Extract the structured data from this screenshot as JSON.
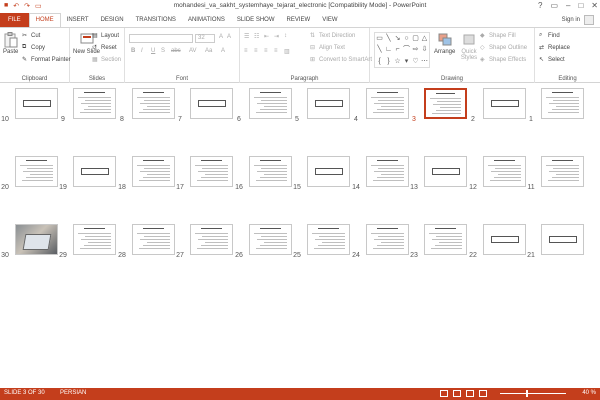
{
  "window": {
    "title": "mohandesi_va_sakht_systemhaye_tejarat_electronic [Compatibility Mode] - PowerPoint",
    "controls": [
      "?",
      "▭",
      "–",
      "□",
      "✕"
    ]
  },
  "tabs": [
    "FILE",
    "HOME",
    "INSERT",
    "DESIGN",
    "TRANSITIONS",
    "ANIMATIONS",
    "SLIDE SHOW",
    "REVIEW",
    "VIEW"
  ],
  "active_tab": "HOME",
  "sign_in": "Sign in",
  "ribbon": {
    "clipboard": {
      "label": "Clipboard",
      "paste": "Paste",
      "cut": "Cut",
      "copy": "Copy",
      "format_painter": "Format Painter"
    },
    "slides": {
      "label": "Slides",
      "new_slide": "New Slide",
      "layout": "Layout",
      "reset": "Reset",
      "section": "Section"
    },
    "font": {
      "label": "Font",
      "size": "32"
    },
    "paragraph": {
      "label": "Paragraph",
      "text_direction": "Text Direction",
      "align_text": "Align Text",
      "convert_smartart": "Convert to SmartArt"
    },
    "drawing": {
      "label": "Drawing",
      "arrange": "Arrange",
      "quick_styles": "Quick Styles",
      "shape_fill": "Shape Fill",
      "shape_outline": "Shape Outline",
      "shape_effects": "Shape Effects"
    },
    "editing": {
      "label": "Editing",
      "find": "Find",
      "replace": "Replace",
      "select": "Select"
    }
  },
  "slides": [
    {
      "num": "1",
      "layout": "text"
    },
    {
      "num": "2",
      "layout": "title"
    },
    {
      "num": "3",
      "layout": "text",
      "selected": true
    },
    {
      "num": "4",
      "layout": "text"
    },
    {
      "num": "5",
      "layout": "title"
    },
    {
      "num": "6",
      "layout": "text"
    },
    {
      "num": "7",
      "layout": "title"
    },
    {
      "num": "8",
      "layout": "text"
    },
    {
      "num": "9",
      "layout": "text"
    },
    {
      "num": "10",
      "layout": "title"
    },
    {
      "num": "11",
      "layout": "text"
    },
    {
      "num": "12",
      "layout": "text"
    },
    {
      "num": "13",
      "layout": "title"
    },
    {
      "num": "14",
      "layout": "text"
    },
    {
      "num": "15",
      "layout": "title"
    },
    {
      "num": "16",
      "layout": "text"
    },
    {
      "num": "17",
      "layout": "text"
    },
    {
      "num": "18",
      "layout": "text"
    },
    {
      "num": "19",
      "layout": "title"
    },
    {
      "num": "20",
      "layout": "text"
    },
    {
      "num": "21",
      "layout": "title"
    },
    {
      "num": "22",
      "layout": "title"
    },
    {
      "num": "23",
      "layout": "text"
    },
    {
      "num": "24",
      "layout": "text"
    },
    {
      "num": "25",
      "layout": "text"
    },
    {
      "num": "26",
      "layout": "text"
    },
    {
      "num": "27",
      "layout": "text"
    },
    {
      "num": "28",
      "layout": "text"
    },
    {
      "num": "29",
      "layout": "text"
    },
    {
      "num": "30",
      "layout": "photo"
    }
  ],
  "status": {
    "slide_of": "SLIDE 3 OF 30",
    "language": "PERSIAN",
    "zoom": "40 %"
  },
  "colors": {
    "accent": "#c43e1c"
  }
}
